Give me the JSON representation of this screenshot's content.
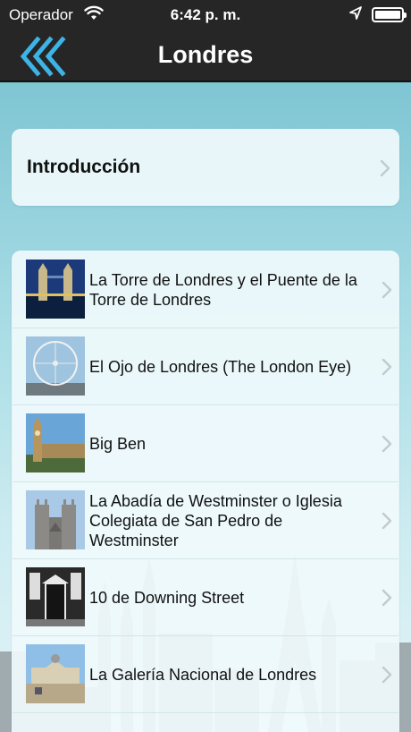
{
  "status_bar": {
    "carrier": "Operador",
    "time": "6:42 p. m."
  },
  "nav": {
    "title": "Londres",
    "back_icon": "triple-chevron-left-icon"
  },
  "intro": {
    "label": "Introducción"
  },
  "list": {
    "items": [
      {
        "title": "La Torre de Londres y el Puente de la Torre de Londres",
        "thumb": "tower-bridge-photo"
      },
      {
        "title": "El Ojo de Londres (The London Eye)",
        "thumb": "london-eye-photo"
      },
      {
        "title": "Big Ben",
        "thumb": "big-ben-photo"
      },
      {
        "title": "La Abadía de Westminster o Iglesia Colegiata de San Pedro de Westminster",
        "thumb": "westminster-abbey-photo"
      },
      {
        "title": "10 de Downing Street",
        "thumb": "downing-street-photo"
      },
      {
        "title": "La Galería Nacional de Londres",
        "thumb": "national-gallery-photo"
      }
    ]
  },
  "colors": {
    "bar": "#262626",
    "accent": "#3db3e6"
  }
}
